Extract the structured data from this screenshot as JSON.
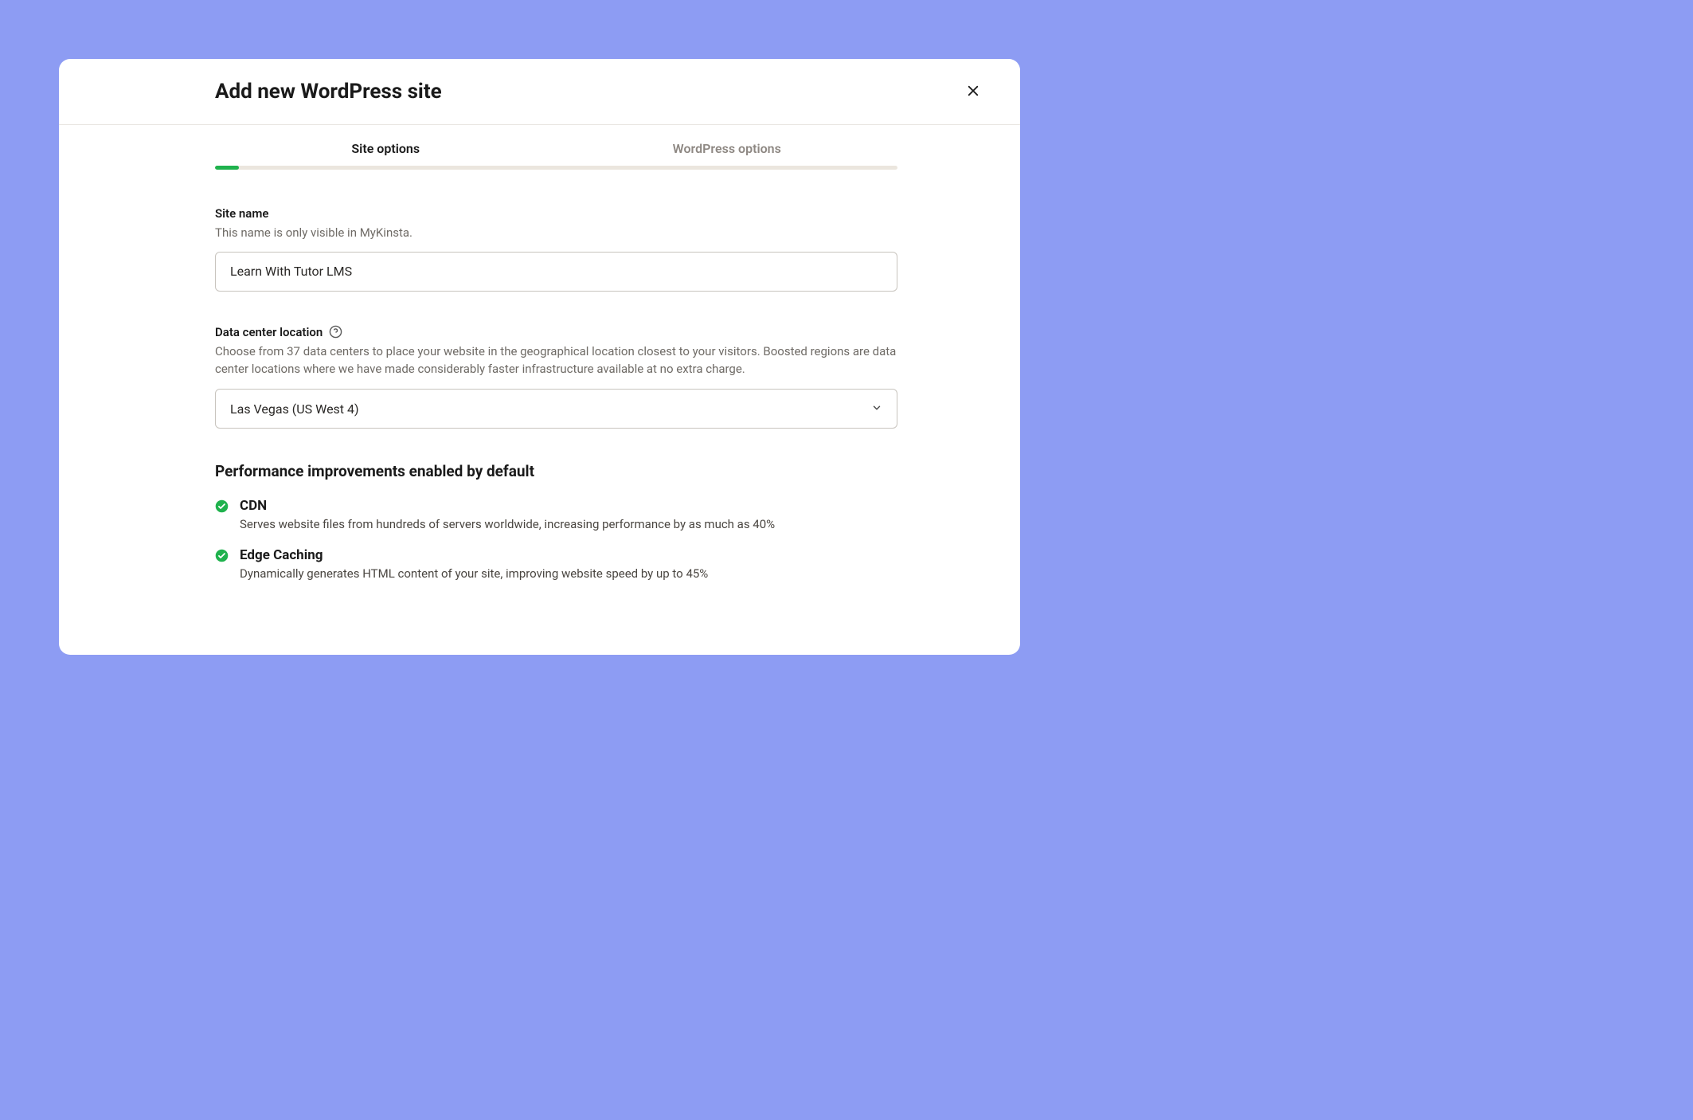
{
  "modal": {
    "title": "Add new WordPress site"
  },
  "tabs": {
    "site_options": "Site options",
    "wordpress_options": "WordPress options"
  },
  "site_name": {
    "label": "Site name",
    "hint": "This name is only visible in MyKinsta.",
    "value": "Learn With Tutor LMS"
  },
  "data_center": {
    "label": "Data center location",
    "hint": "Choose from 37 data centers to place your website in the geographical location closest to your visitors. Boosted regions are data center locations where we have made considerably faster infrastructure available at no extra charge.",
    "value": "Las Vegas (US West 4)"
  },
  "performance": {
    "title": "Performance improvements enabled by default",
    "cdn": {
      "title": "CDN",
      "desc": "Serves website files from hundreds of servers worldwide, increasing performance by as much as 40%"
    },
    "edge_caching": {
      "title": "Edge Caching",
      "desc": "Dynamically generates HTML content of your site, improving website speed by up to 45%"
    }
  }
}
